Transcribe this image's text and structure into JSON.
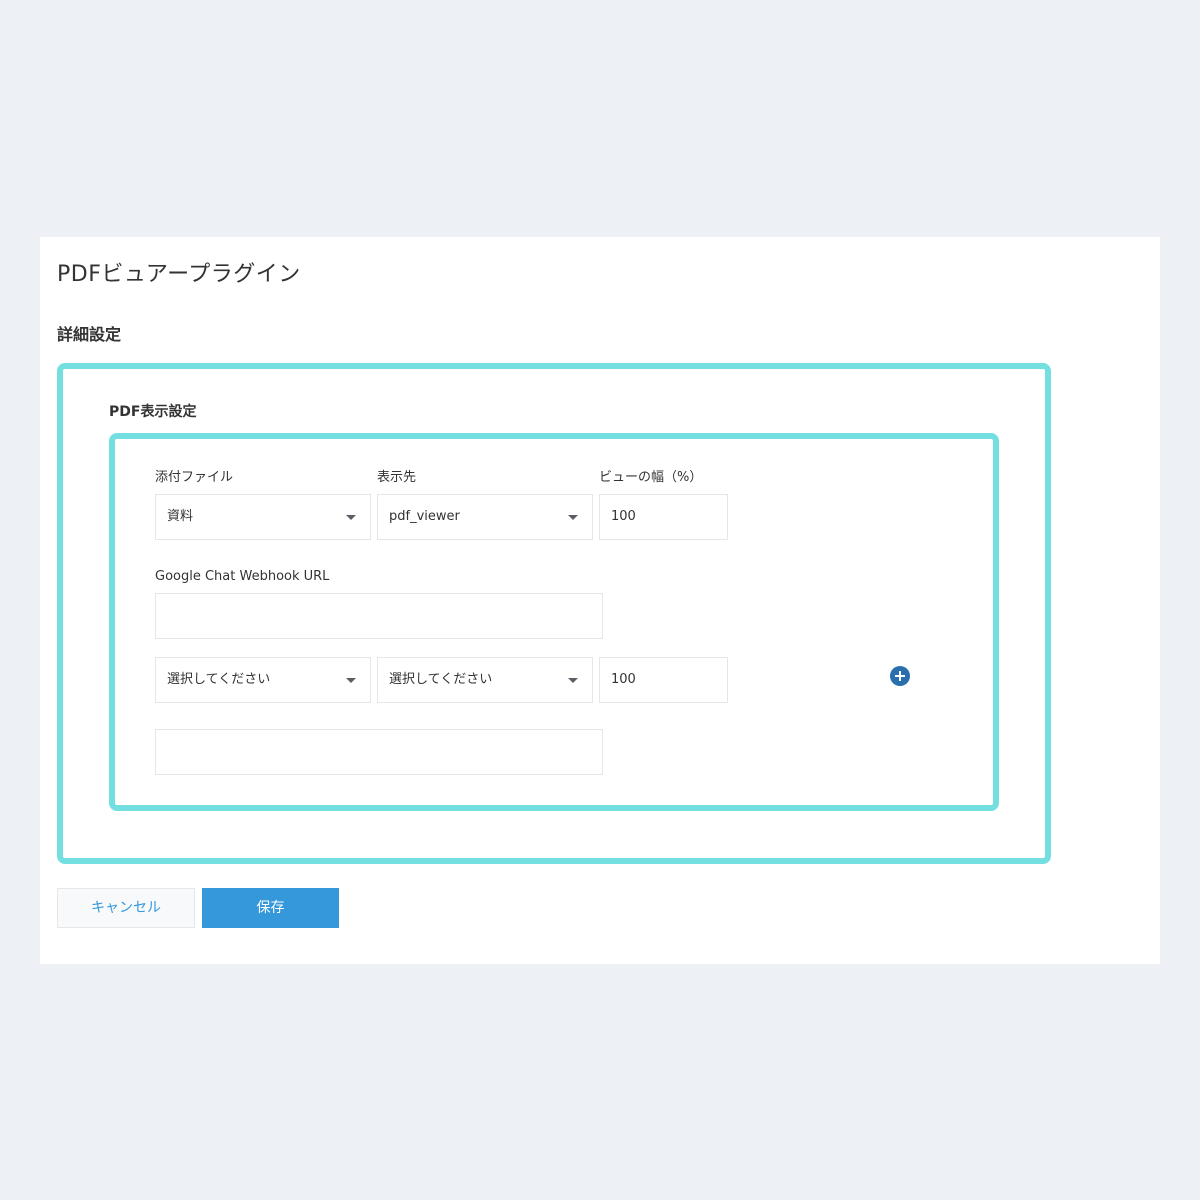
{
  "header": {
    "page_title": "PDFビュアープラグイン",
    "section_title": "詳細設定"
  },
  "pdf_settings": {
    "group_title": "PDF表示設定",
    "labels": {
      "attachment": "添付ファイル",
      "target": "表示先",
      "width": "ビューの幅（%）",
      "webhook": "Google Chat Webhook URL"
    },
    "rows": [
      {
        "attachment": "資料",
        "target": "pdf_viewer",
        "width": "100",
        "webhook": ""
      },
      {
        "attachment": "選択してください",
        "target": "選択してください",
        "width": "100",
        "webhook": ""
      }
    ]
  },
  "icons": {
    "add": "plus-circle-icon",
    "dropdown": "caret-down-icon"
  },
  "actions": {
    "cancel_label": "キャンセル",
    "save_label": "保存"
  },
  "colors": {
    "accent": "#3498db",
    "highlight": "#74dfe0",
    "add_icon": "#2a6fad"
  }
}
